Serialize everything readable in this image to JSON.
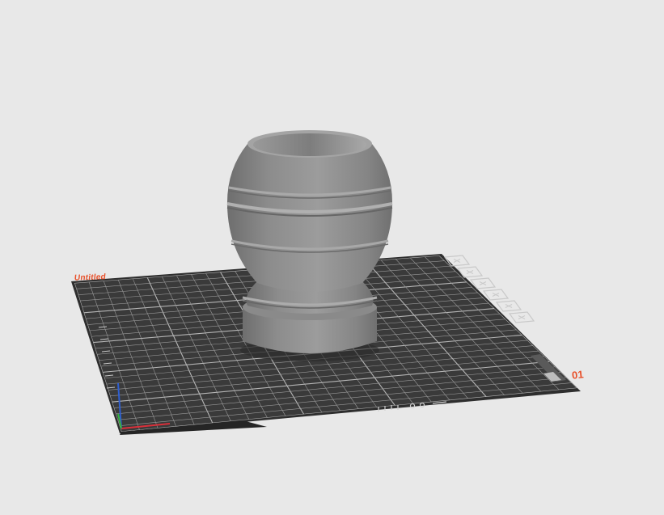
{
  "plate": {
    "name": "Untitled",
    "number": "01"
  },
  "colors": {
    "background": "#e8e8e8",
    "plate_surface": "#3a3a3a",
    "grid_line": "#9a9a9a",
    "model_fill": "#8f8f8f",
    "accent": "#e8502a",
    "axis_x": "#d9303a",
    "axis_y": "#35b03a",
    "axis_z": "#2f5fd0"
  },
  "plate_toolbar": {
    "buttons": [
      {
        "icon": "close-icon"
      },
      {
        "icon": "lock-icon"
      },
      {
        "icon": "arrange-icon"
      },
      {
        "icon": "orient-icon"
      },
      {
        "icon": "settings-icon"
      },
      {
        "icon": "pick-icon"
      }
    ]
  },
  "model": {
    "name": "vase"
  }
}
